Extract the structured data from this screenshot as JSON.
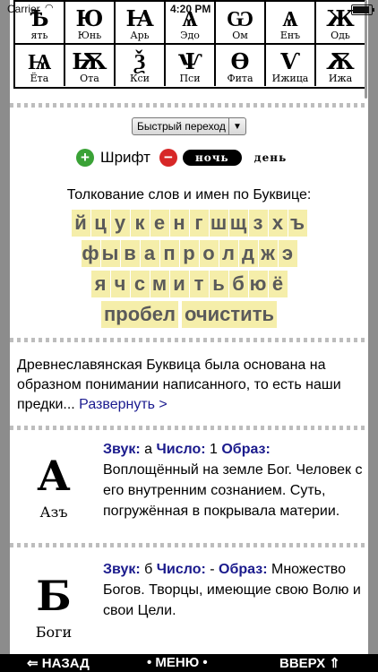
{
  "status_bar": {
    "carrier": "Carrier",
    "time": "4:20 PM"
  },
  "letters_top": [
    {
      "glyph": "Ѣ",
      "name": "ять"
    },
    {
      "glyph": "Ю",
      "name": "Юнь"
    },
    {
      "glyph": "Ꙗ",
      "name": "Арь"
    },
    {
      "glyph": "Ѧ",
      "name": "Эдо"
    },
    {
      "glyph": "Ѡ",
      "name": "Ом"
    },
    {
      "glyph": "Ѧ",
      "name": "Енъ"
    },
    {
      "glyph": "Ж",
      "name": "Одь"
    }
  ],
  "letters_bottom": [
    {
      "glyph": "Ѩ",
      "name": "Ёта"
    },
    {
      "glyph": "Ѭ",
      "name": "Ота"
    },
    {
      "glyph": "Ѯ",
      "name": "Кси"
    },
    {
      "glyph": "Ѱ",
      "name": "Пси"
    },
    {
      "glyph": "Ѳ",
      "name": "Фита"
    },
    {
      "glyph": "Ѵ",
      "name": "Ижица"
    },
    {
      "glyph": "Ѫ",
      "name": "Ижа"
    }
  ],
  "quick_jump": {
    "label": "Быстрый переход"
  },
  "font_controls": {
    "font_label": "Шрифт",
    "night_label": "ночь",
    "day_label": "день"
  },
  "keyboard": {
    "title": "Толкование слов и имен по Буквице:",
    "row1": [
      "й",
      "ц",
      "у",
      "к",
      "е",
      "н",
      "г",
      "ш",
      "щ",
      "з",
      "х",
      "ъ"
    ],
    "row2": [
      "ф",
      "ы",
      "в",
      "а",
      "п",
      "р",
      "о",
      "л",
      "д",
      "ж",
      "э"
    ],
    "row3": [
      "я",
      "ч",
      "с",
      "м",
      "и",
      "т",
      "ь",
      "б",
      "ю",
      "ё"
    ],
    "space_label": "пробел",
    "clear_label": "очистить"
  },
  "intro": {
    "text": "Древнеславянская Буквица была основана на образном понимании написанного, то есть наши предки...",
    "expand_label": "Развернуть >"
  },
  "entries": [
    {
      "glyph": "А",
      "caption": "Азъ",
      "sound_label": "Звук:",
      "sound": "а",
      "number_label": "Число:",
      "number": "1",
      "image_label": "Образ:",
      "image_text": "Воплощённый на земле Бог. Человек с его внутренним сознанием. Суть, погружённая в покрывала материи."
    },
    {
      "glyph": "Б",
      "caption": "Боги",
      "sound_label": "Звук:",
      "sound": "б",
      "number_label": "Число:",
      "number": "-",
      "image_label": "Образ:",
      "image_text": "Множество Богов. Творцы, имеющие свою Волю и свои Цели."
    }
  ],
  "bottom_bar": {
    "back_label": "⇐ НАЗАД",
    "menu_label": "• МЕНЮ •",
    "up_label": "ВВЕРХ ⇑"
  }
}
